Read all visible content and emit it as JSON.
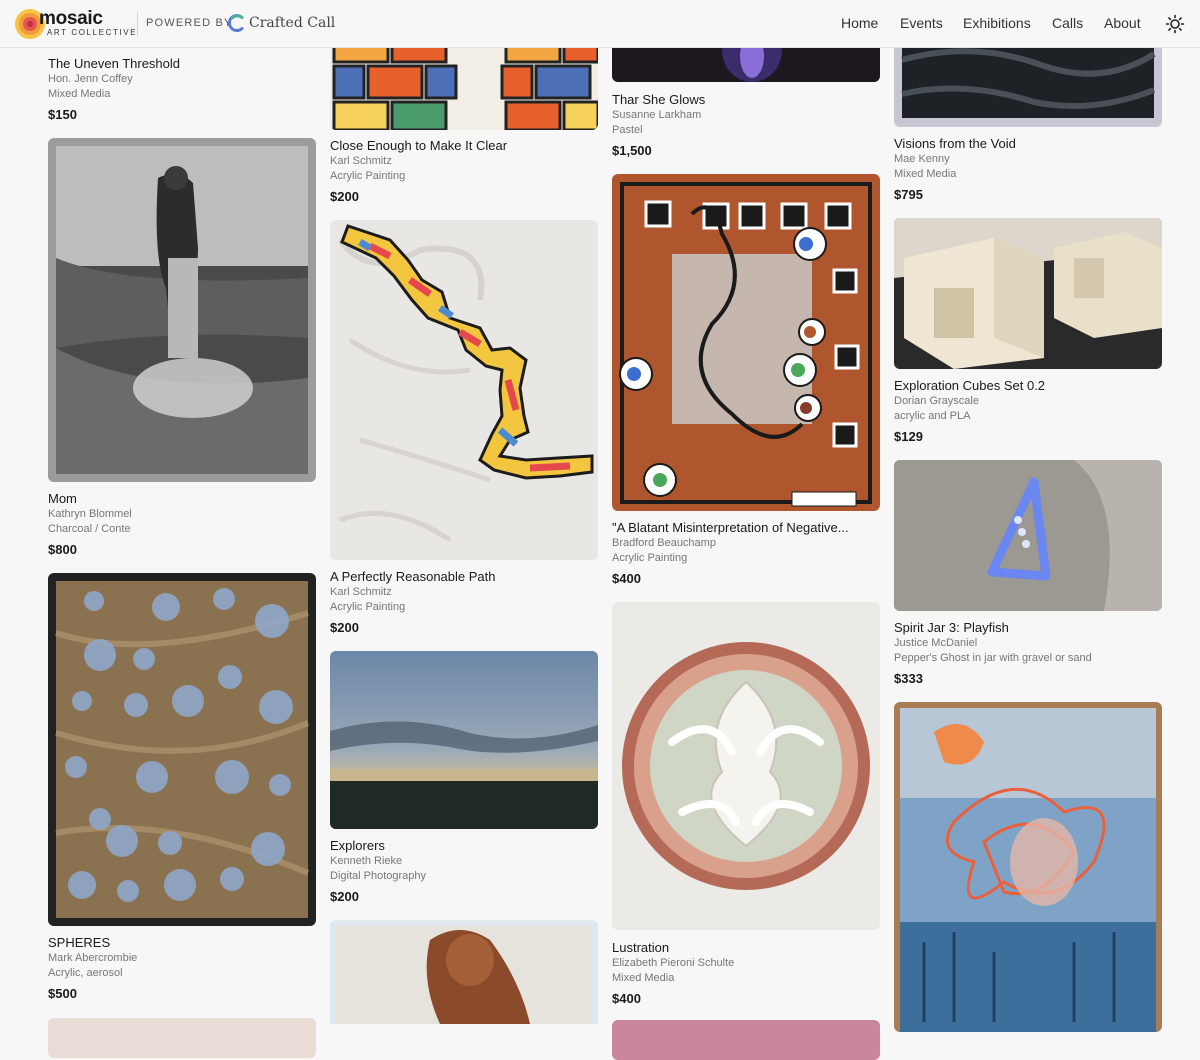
{
  "header": {
    "logo_word": "mosaic",
    "logo_sub": "ART COLLECTIVE",
    "powered_by": "POWERED BY",
    "partner": "Crafted Call",
    "nav": [
      "Home",
      "Events",
      "Exhibitions",
      "Calls",
      "About"
    ],
    "theme_icon": "sun-icon"
  },
  "columns": [
    [
      {
        "title": "The Uneven Threshold",
        "artist": "Hon. Jenn Coffey",
        "medium": "Mixed Media",
        "price": "$150"
      },
      {
        "title": "Mom",
        "artist": "Kathryn Blommel",
        "medium": "Charcoal / Conte",
        "price": "$800"
      },
      {
        "title": "SPHERES",
        "artist": "Mark Abercrombie",
        "medium": "Acrylic, aerosol",
        "price": "$500"
      }
    ],
    [
      {
        "title": "Close Enough to Make It Clear",
        "artist": "Karl Schmitz",
        "medium": "Acrylic Painting",
        "price": "$200"
      },
      {
        "title": "A Perfectly Reasonable Path",
        "artist": "Karl Schmitz",
        "medium": "Acrylic Painting",
        "price": "$200"
      },
      {
        "title": "Explorers",
        "artist": "Kenneth Rieke",
        "medium": "Digital Photography",
        "price": "$200"
      }
    ],
    [
      {
        "title": "Thar She Glows",
        "artist": "Susanne Larkham",
        "medium": "Pastel",
        "price": "$1,500"
      },
      {
        "title": "\"A Blatant Misinterpretation of Negative...",
        "artist": "Bradford Beauchamp",
        "medium": "Acrylic Painting",
        "price": "$400"
      },
      {
        "title": "Lustration",
        "artist": "Elizabeth Pieroni Schulte",
        "medium": "Mixed Media",
        "price": "$400"
      }
    ],
    [
      {
        "title": "Visions from the Void",
        "artist": "Mae Kenny",
        "medium": "Mixed Media",
        "price": "$795"
      },
      {
        "title": "Exploration Cubes Set 0.2",
        "artist": "Dorian Grayscale",
        "medium": "acrylic and PLA",
        "price": "$129"
      },
      {
        "title": "Spirit Jar 3: Playfish",
        "artist": "Justice McDaniel",
        "medium": "Pepper's Ghost in jar with gravel or sand",
        "price": "$333"
      }
    ]
  ],
  "artwork_images": [
    "mom-artwork",
    "spheres-artwork",
    "close-enough-artwork",
    "perfectly-reasonable-path-artwork",
    "explorers-photo",
    "portrait-artwork",
    "thar-she-glows-artwork",
    "blatant-misinterpretation-artwork",
    "lustration-artwork",
    "visions-void-artwork",
    "exploration-cubes-photo",
    "spirit-jar-photo",
    "abstract-blue-orange-artwork"
  ],
  "colors": {
    "background": "#f7f7f7",
    "text": "#1a1a1a",
    "muted": "#777777"
  }
}
